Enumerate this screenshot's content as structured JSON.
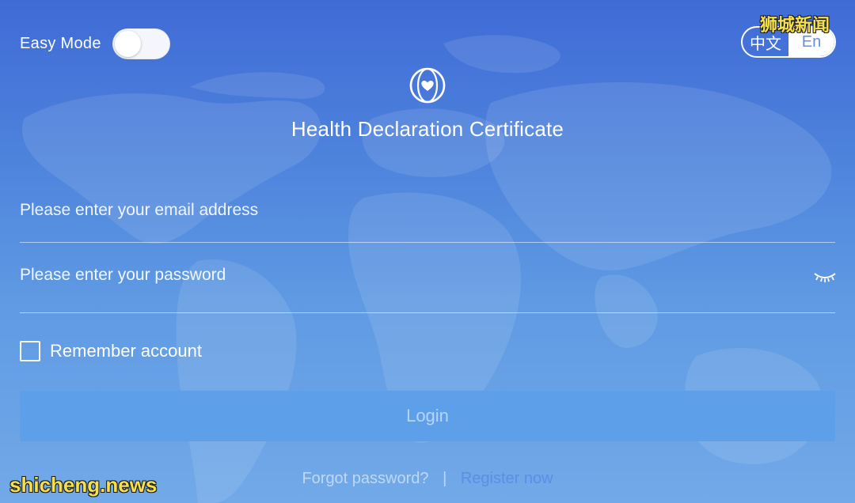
{
  "easy_mode": {
    "label": "Easy Mode",
    "enabled": false
  },
  "language": {
    "options": [
      "中文",
      "En"
    ],
    "selected": "En"
  },
  "watermarks": {
    "top": "狮城新闻",
    "bottom": "shicheng.news"
  },
  "app": {
    "logo_icon": "globe-heart-icon",
    "title": "Health Declaration Certificate"
  },
  "form": {
    "email_placeholder": "Please enter your email address",
    "email_value": "",
    "password_placeholder": "Please enter your password",
    "password_value": "",
    "password_toggle_icon": "eye-closed-icon",
    "remember_label": "Remember account",
    "remember_checked": false,
    "login_label": "Login"
  },
  "footer": {
    "forgot_label": "Forgot password?",
    "separator": "|",
    "register_label": "Register now"
  },
  "colors": {
    "background_top": "#3f6bd6",
    "background_bottom": "#72a9e8",
    "button": "#5e9fea",
    "register_link": "#5b8ee6",
    "watermark": "#f5e04a"
  }
}
